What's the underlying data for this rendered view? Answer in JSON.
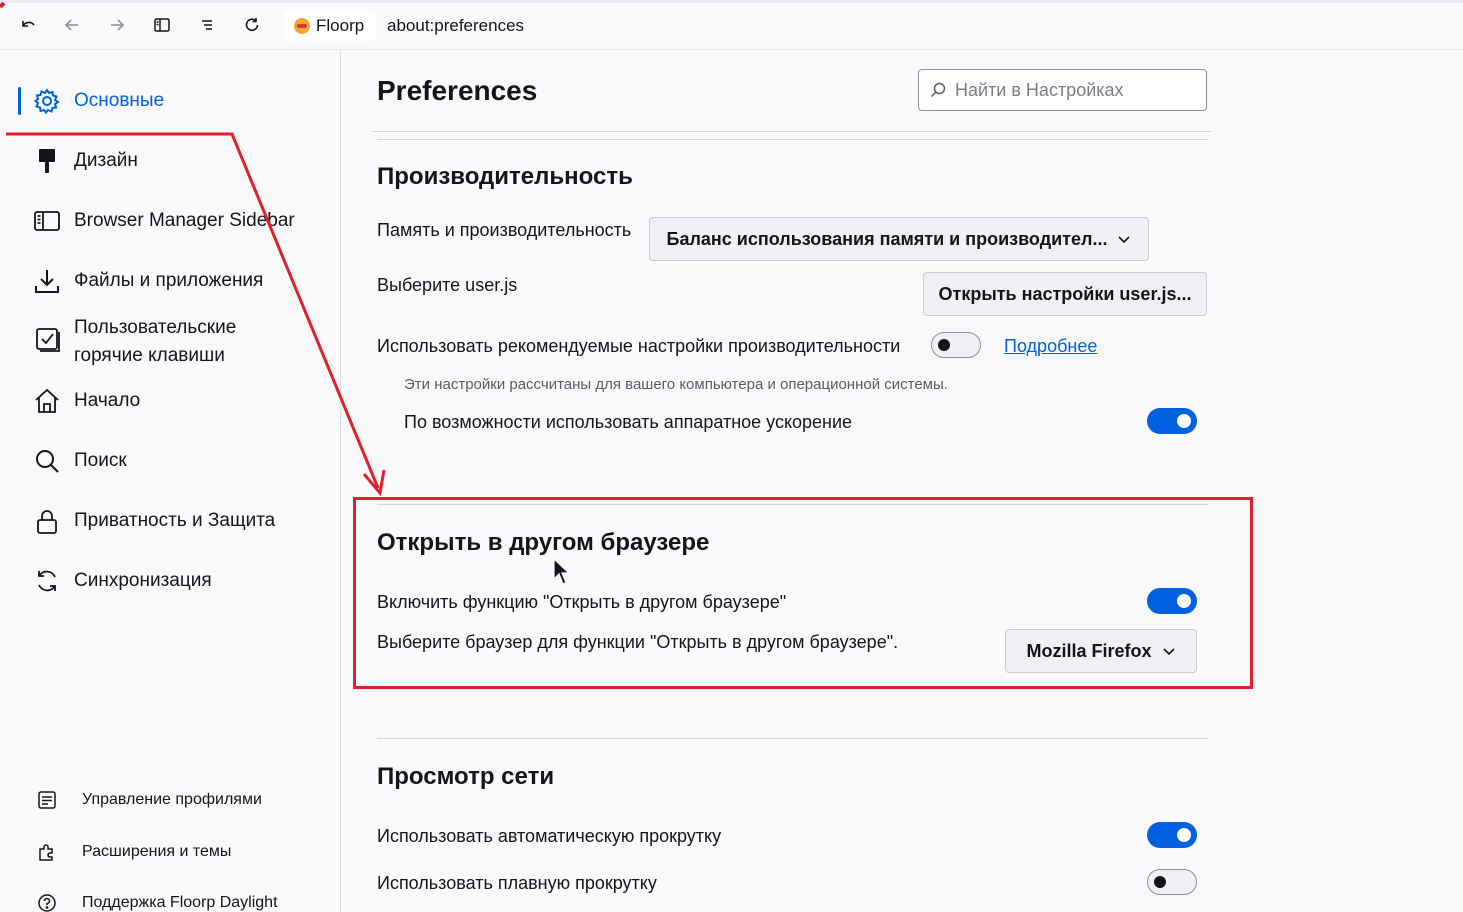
{
  "toolbar": {
    "identity_label": "Floorp",
    "url": "about:preferences",
    "icons": [
      "undo-icon",
      "back-arrow-icon",
      "forward-arrow-icon",
      "sidebar-toggle-icon",
      "list-icon",
      "reload-icon"
    ]
  },
  "sidebar": {
    "items": [
      {
        "label": "Основные",
        "icon": "gear-icon",
        "active": true
      },
      {
        "label": "Дизайн",
        "icon": "paintbrush-icon"
      },
      {
        "label": "Browser Manager Sidebar",
        "icon": "sidebar-icon"
      },
      {
        "label": "Файлы и приложения",
        "icon": "download-icon"
      },
      {
        "label_line1": "Пользовательские",
        "label_line2": "горячие клавиши",
        "icon": "checkbox-icon"
      },
      {
        "label": "Начало",
        "icon": "home-icon"
      },
      {
        "label": "Поиск",
        "icon": "search-icon"
      },
      {
        "label": "Приватность и Защита",
        "icon": "lock-icon"
      },
      {
        "label": "Синхронизация",
        "icon": "sync-icon"
      }
    ],
    "footer": [
      {
        "label": "Управление профилями",
        "icon": "profile-icon"
      },
      {
        "label": "Расширения и темы",
        "icon": "puzzle-icon"
      },
      {
        "label": "Поддержка Floorp Daylight",
        "icon": "help-icon"
      }
    ]
  },
  "main": {
    "title": "Preferences",
    "search_placeholder": "Найти в Настройках",
    "performance": {
      "title": "Производительность",
      "memory_label": "Память и производительность",
      "memory_value": "Баланс использования памяти и производител...",
      "userjs_label": "Выберите user.js",
      "userjs_button": "Открыть настройки user.js...",
      "recommended_label": "Использовать рекомендуемые настройки производительности",
      "recommended_on": false,
      "learn_more": "Подробнее",
      "hint": "Эти настройки рассчитаны для вашего компьютера и операционной системы.",
      "hw_accel_label": "По возможности использовать аппаратное ускорение",
      "hw_accel_on": true
    },
    "open_in_other": {
      "title": "Открыть в другом браузере",
      "enable_label": "Включить функцию \"Открыть в другом браузере\"",
      "enable_on": true,
      "choose_label": "Выберите браузер для функции \"Открыть в другом браузере\".",
      "browser_value": "Mozilla Firefox"
    },
    "browsing": {
      "title": "Просмотр сети",
      "autoscroll_label": "Использовать автоматическую прокрутку",
      "autoscroll_on": true,
      "smooth_label": "Использовать плавную прокрутку",
      "smooth_on": false
    }
  },
  "colors": {
    "accent": "#0061e0",
    "annotation_red": "#e0202a"
  }
}
